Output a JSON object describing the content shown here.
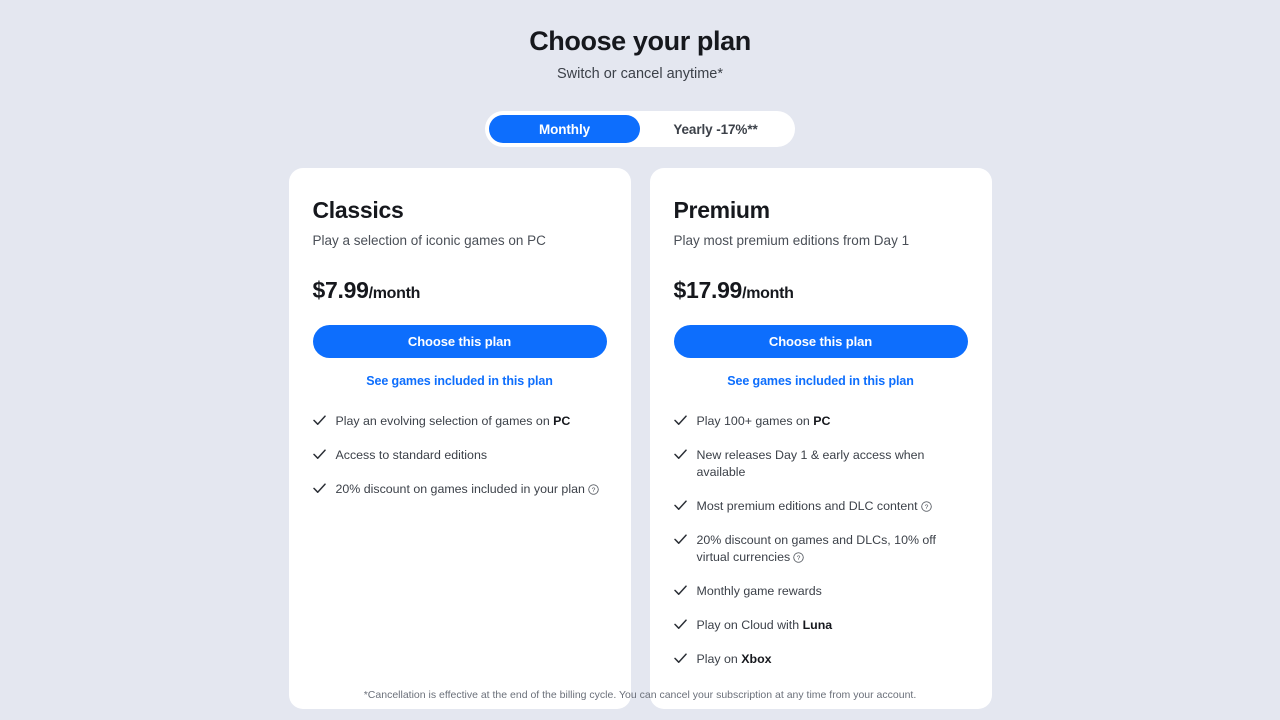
{
  "header": {
    "title": "Choose your plan",
    "subtitle": "Switch or cancel anytime*"
  },
  "billing_toggle": {
    "selected": "Monthly",
    "options": [
      {
        "label": "Monthly",
        "active": true
      },
      {
        "label": "Yearly -17%**",
        "active": false
      }
    ]
  },
  "colors": {
    "background": "#e4e7f0",
    "card": "#ffffff",
    "accent": "#0d6efd",
    "text": "#16181d",
    "muted": "#3c4149"
  },
  "plans": [
    {
      "name": "Classics",
      "tagline": "Play a selection of iconic games on PC",
      "price": "$7.99",
      "period": "/month",
      "cta_label": "Choose this plan",
      "link_label": "See games included in this plan",
      "features": [
        {
          "text": "Play an evolving selection of games on ",
          "bold": "PC",
          "after": "",
          "info": false
        },
        {
          "text": "Access to standard editions",
          "bold": "",
          "after": "",
          "info": false
        },
        {
          "text": "20% discount on games included in your plan",
          "bold": "",
          "after": "",
          "info": true
        }
      ]
    },
    {
      "name": "Premium",
      "tagline": "Play most premium editions from Day 1",
      "price": "$17.99",
      "period": "/month",
      "cta_label": "Choose this plan",
      "link_label": "See games included in this plan",
      "features": [
        {
          "text": "Play 100+ games on ",
          "bold": "PC",
          "after": "",
          "info": false
        },
        {
          "text": "New releases Day 1 & early access when available",
          "bold": "",
          "after": "",
          "info": false
        },
        {
          "text": "Most premium editions and DLC content",
          "bold": "",
          "after": "",
          "info": true
        },
        {
          "text": "20% discount on games and DLCs, 10% off virtual currencies",
          "bold": "",
          "after": "",
          "info": true
        },
        {
          "text": "Monthly game rewards",
          "bold": "",
          "after": "",
          "info": false
        },
        {
          "text": "Play on Cloud with ",
          "bold": "Luna",
          "after": "",
          "info": false
        },
        {
          "text": "Play on ",
          "bold": "Xbox",
          "after": "",
          "info": false
        }
      ]
    }
  ],
  "footnote": "*Cancellation is effective at the end of the billing cycle. You can cancel your subscription at any time from your account.",
  "icons": {
    "check": "check-icon",
    "info": "info-question-icon"
  }
}
